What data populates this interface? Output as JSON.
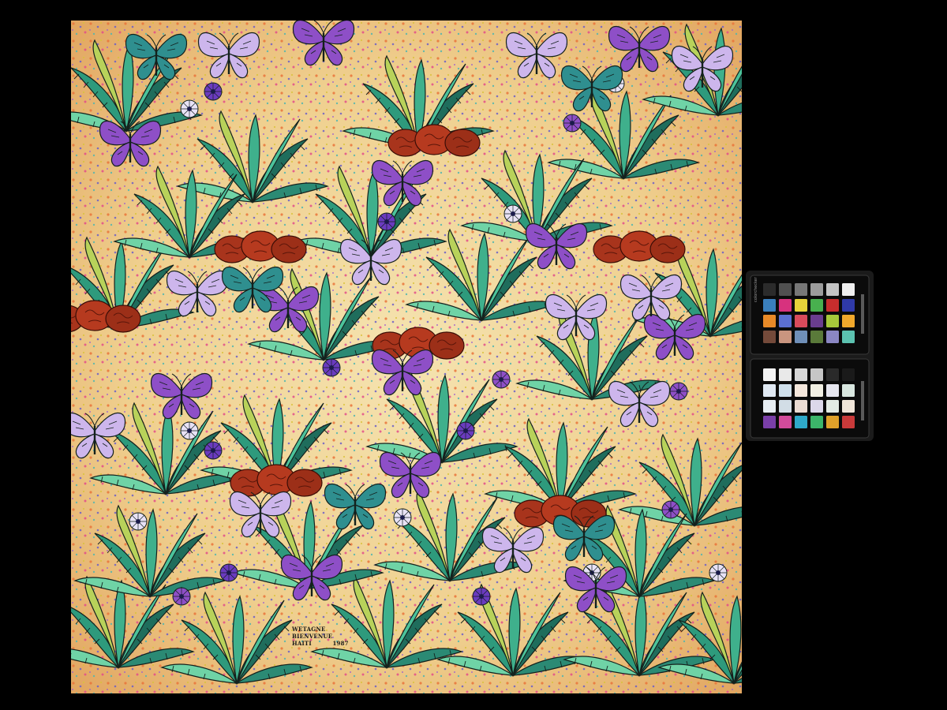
{
  "scene": {
    "subject": "painting",
    "palette": {
      "background": "#000000",
      "ground_light": "#f3dfa8",
      "ground_warm": "#e9a35a",
      "fern_dark": "#1f6d5c",
      "fern_mid": "#2e9a7c",
      "fern_light": "#6fd3a6",
      "fern_yellow": "#b8d25a",
      "butterfly_violet": "#8e4fc7",
      "butterfly_lilac": "#cdb6ec",
      "butterfly_teal": "#2f8f8f",
      "mound_red": "#a8341c",
      "flower_purple": "#6a3bbf",
      "flower_white": "#e8e2f6",
      "outline": "#14211d"
    }
  },
  "signature": {
    "line1": "WETAGNE",
    "line2": "BIENVENUE",
    "line3": "HAITI",
    "year": "1987"
  },
  "color_checker": {
    "brand": "colorchecker",
    "top_swatches": [
      "#2b2b2b",
      "#505050",
      "#777777",
      "#9c9c9c",
      "#c4c4c4",
      "#efefef",
      "#3a7fbd",
      "#d7327e",
      "#e6d23a",
      "#48b04e",
      "#c72d2d",
      "#2f3aa8",
      "#e78a28",
      "#5b6fd1",
      "#d94b5b",
      "#6a3d8f",
      "#a6c93a",
      "#f0a82c",
      "#744a3a",
      "#c9957f",
      "#6f8fb8",
      "#5a7a3a",
      "#8b87c4",
      "#5cc2b0"
    ],
    "bottom_swatches": [
      "#f3f3f3",
      "#e9e9e9",
      "#d8d8d8",
      "#c6c6c6",
      "#2a2a2a",
      "#1a1a1a",
      "#dfe8f2",
      "#cfe0ec",
      "#f4e7dc",
      "#f1efe3",
      "#e6e6ef",
      "#d8e6df",
      "#e7eef3",
      "#d2dde6",
      "#eadbd2",
      "#dcd8ea",
      "#e3ebe4",
      "#efe5d8",
      "#7a3fa8",
      "#d24b9b",
      "#2fa9c9",
      "#3cb56a",
      "#e0a12a",
      "#c93a3a"
    ]
  }
}
